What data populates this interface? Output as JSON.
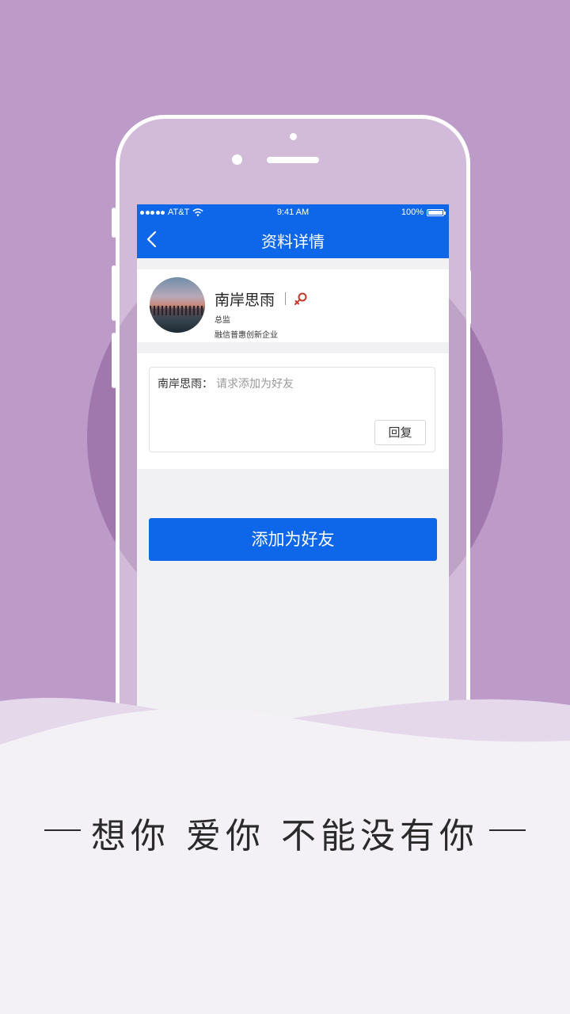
{
  "status_bar": {
    "carrier": "AT&T",
    "time": "9:41 AM",
    "battery": "100%"
  },
  "nav": {
    "title": "资料详情"
  },
  "profile": {
    "name": "南岸思雨",
    "role": "总监",
    "company": "融信普惠创新企业"
  },
  "message": {
    "from": "南岸思雨：",
    "text": "请求添加为好友",
    "reply_label": "回复"
  },
  "actions": {
    "add_friend_label": "添加为好友"
  },
  "slogan": "想你 爱你 不能没有你",
  "colors": {
    "accent": "#0e67e8",
    "background": "#bc9bc8",
    "circle": "#a078ad",
    "gender_icon": "#c0392b"
  },
  "icons": {
    "back": "chevron-left-icon",
    "gender": "female-icon",
    "wifi": "wifi-icon",
    "battery": "battery-icon"
  }
}
